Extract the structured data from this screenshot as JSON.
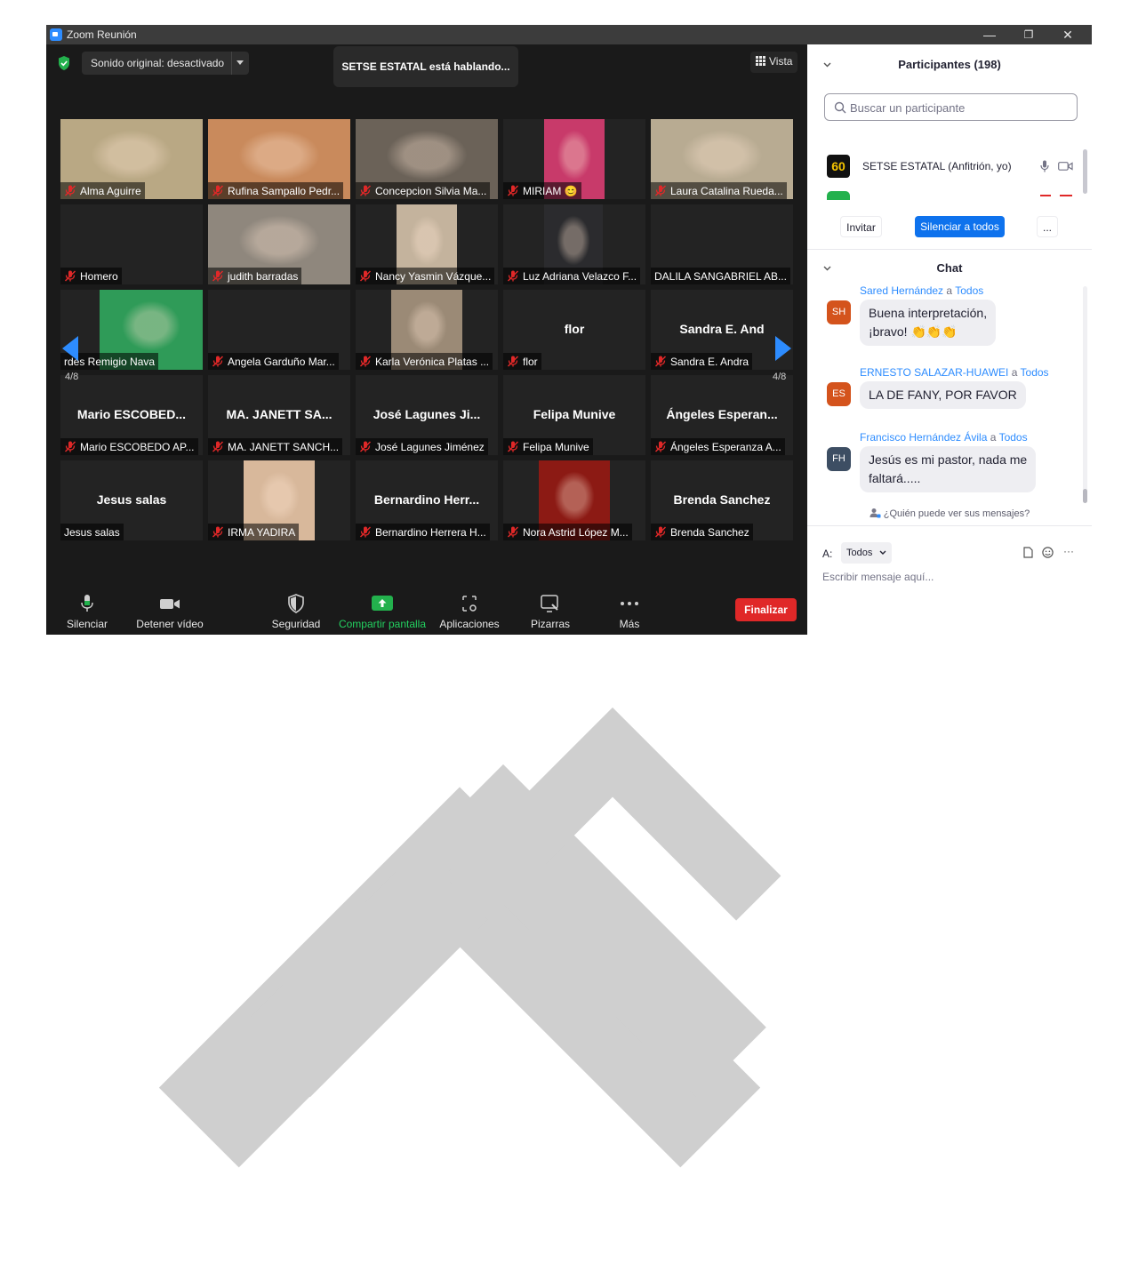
{
  "window": {
    "title": "Zoom Reunión",
    "minimize": "—",
    "restore": "❐",
    "close": "✕"
  },
  "meeting": {
    "audio_label": "Sonido original: desactivado",
    "speaking": "SETSE ESTATAL está hablando...",
    "view_label": "Vista",
    "page_left": "4/8",
    "page_right": "4/8"
  },
  "tiles": [
    {
      "label": "Alma Aguirre",
      "muted": true,
      "photo": "#b9a884"
    },
    {
      "label": "Rufina Sampallo Pedr...",
      "muted": true,
      "photo": "#c98a5c"
    },
    {
      "label": "Concepcion Silvia Ma...",
      "muted": true,
      "photo": "#6b6258"
    },
    {
      "label": "MIRIAM 😊",
      "muted": true,
      "photo": "#c83a6a"
    },
    {
      "label": "Laura Catalina Rueda...",
      "muted": true,
      "photo": "#b8ab92"
    },
    {
      "label": "Homero",
      "muted": true
    },
    {
      "label": "judith barradas",
      "muted": true,
      "photo": "#8f877d"
    },
    {
      "label": "Nancy Yasmin Vázque...",
      "muted": true,
      "photo": "#c4b39d"
    },
    {
      "label": "Luz Adriana Velazco F...",
      "muted": true,
      "photo": "#2b2b2e"
    },
    {
      "label": "DALILA SANGABRIEL AB...",
      "muted": false
    },
    {
      "label": "rdes Remigio Nava",
      "muted": false,
      "photo": "#2f9b58"
    },
    {
      "label": "Angela Garduño Mar...",
      "muted": true
    },
    {
      "label": "Karla Verónica Platas ...",
      "muted": true,
      "photo": "#9b8a76"
    },
    {
      "label": "flor",
      "muted": true,
      "bigname": "flor"
    },
    {
      "label": "Sandra E. Andra",
      "muted": true,
      "bigname": "Sandra E. And"
    },
    {
      "label": "Mario ESCOBEDO AP...",
      "muted": true,
      "bigname": "Mario  ESCOBED..."
    },
    {
      "label": "MA. JANETT SANCH...",
      "muted": true,
      "bigname": "MA.  JANETT SA..."
    },
    {
      "label": "José Lagunes Jiménez",
      "muted": true,
      "bigname": "José Lagunes Ji..."
    },
    {
      "label": "Felipa Munive",
      "muted": true,
      "bigname": "Felipa Munive"
    },
    {
      "label": "Ángeles Esperanza A...",
      "muted": true,
      "bigname": "Ángeles  Esperan..."
    },
    {
      "label": "Jesus salas",
      "muted": false,
      "bigname": "Jesus salas"
    },
    {
      "label": "IRMA YADIRA",
      "muted": true,
      "photo": "#d8b89b"
    },
    {
      "label": "Bernardino Herrera H...",
      "muted": true,
      "bigname": "Bernardino  Herr..."
    },
    {
      "label": "Nora Astrid López M...",
      "muted": true,
      "photo": "#8c1a14"
    },
    {
      "label": "Brenda Sanchez",
      "muted": true,
      "bigname": "Brenda Sanchez"
    }
  ],
  "toolbar": {
    "mute": "Silenciar",
    "video": "Detener vídeo",
    "security": "Seguridad",
    "share": "Compartir pantalla",
    "apps": "Aplicaciones",
    "whiteboards": "Pizarras",
    "more": "Más",
    "end": "Finalizar"
  },
  "participants": {
    "title": "Participantes (198)",
    "search_placeholder": "Buscar un participante",
    "host_name": "SETSE ESTATAL (Anfitrión, yo)",
    "host_avatar": "60",
    "invite": "Invitar",
    "mute_all": "Silenciar a todos",
    "more": "..."
  },
  "chat": {
    "title": "Chat",
    "messages": [
      {
        "from": "Sared Hernández",
        "to": "Todos",
        "initials": "SH",
        "color": "#d4531c",
        "text_lines": [
          "Buena interpretación,",
          "¡bravo! 👏👏👏"
        ]
      },
      {
        "from": "ERNESTO SALAZAR-HUAWEI",
        "to": "Todos",
        "initials": "ES",
        "color": "#d4531c",
        "text_lines": [
          "LA DE FANY, POR FAVOR"
        ]
      },
      {
        "from": "Francisco Hernández Ávila",
        "to": "Todos",
        "initials": "FH",
        "color": "#3d4e63",
        "text_lines": [
          "Jesús es mi pastor, nada me",
          "faltará....."
        ]
      }
    ],
    "to_word": "a",
    "who_can_see": "¿Quién puede ver sus mensajes?",
    "to_label": "A:",
    "to_value": "Todos",
    "compose_placeholder": "Escribir mensaje aquí...",
    "more": "···"
  }
}
